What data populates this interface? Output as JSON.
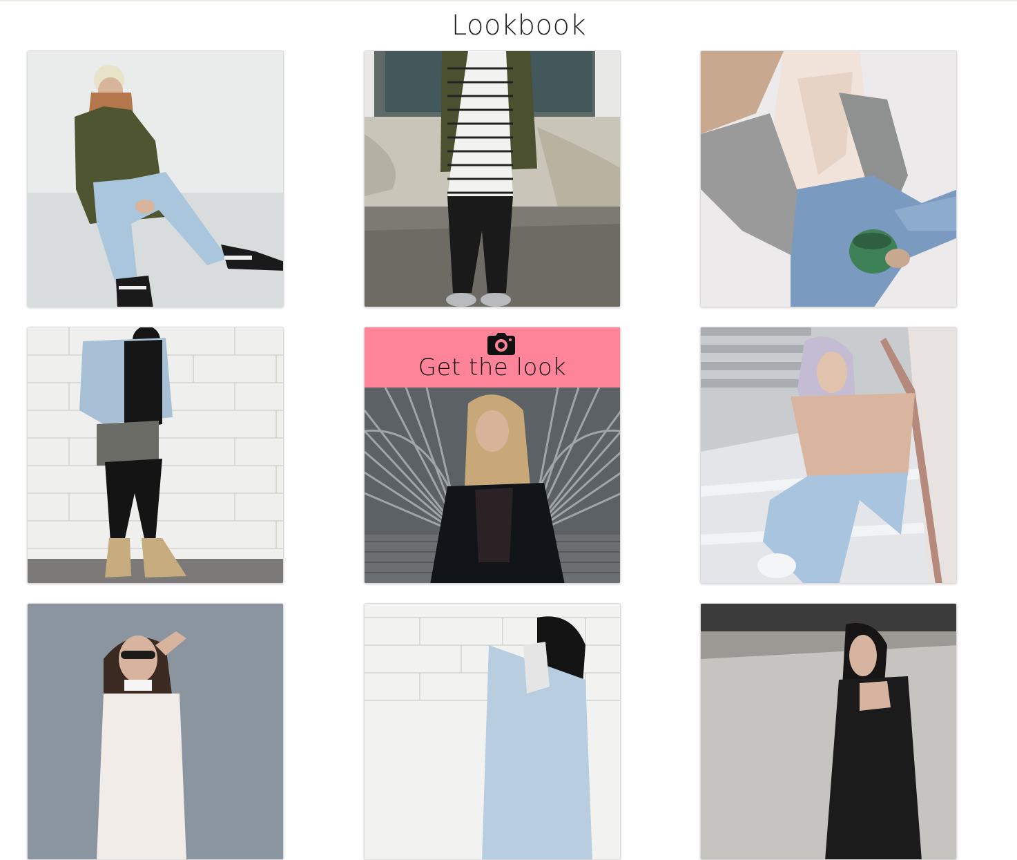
{
  "page": {
    "title": "Lookbook"
  },
  "hover_overlay": {
    "label": "Get the look",
    "icon": "camera-icon",
    "color": "#ff8499"
  },
  "looks": [
    {
      "id": "look-1",
      "desc": "man in olive bomber, ripped light jeans, sitting against white wall"
    },
    {
      "id": "look-2",
      "desc": "olive bomber, striped long tee, black ripped jeans, grey sneakers by weathered wall"
    },
    {
      "id": "look-3",
      "desc": "grey cardigan over lace cami, ripped jeans, holding green mug"
    },
    {
      "id": "look-4",
      "desc": "denim jacket over black hoodie, black skinny jeans, tan boots by brick wall"
    },
    {
      "id": "look-5",
      "desc": "woman in black leather jacket and lace top in front of metal gate",
      "hover": true
    },
    {
      "id": "look-6",
      "desc": "lavender hair, peach crop tee, light jeans, white sneakers on stairs"
    },
    {
      "id": "look-7",
      "desc": "woman with sunglasses and choker against grey wall"
    },
    {
      "id": "look-8",
      "desc": "denim jacket with black hood, white brick wall"
    },
    {
      "id": "look-9",
      "desc": "woman with black bob in black top, outdoor"
    }
  ]
}
